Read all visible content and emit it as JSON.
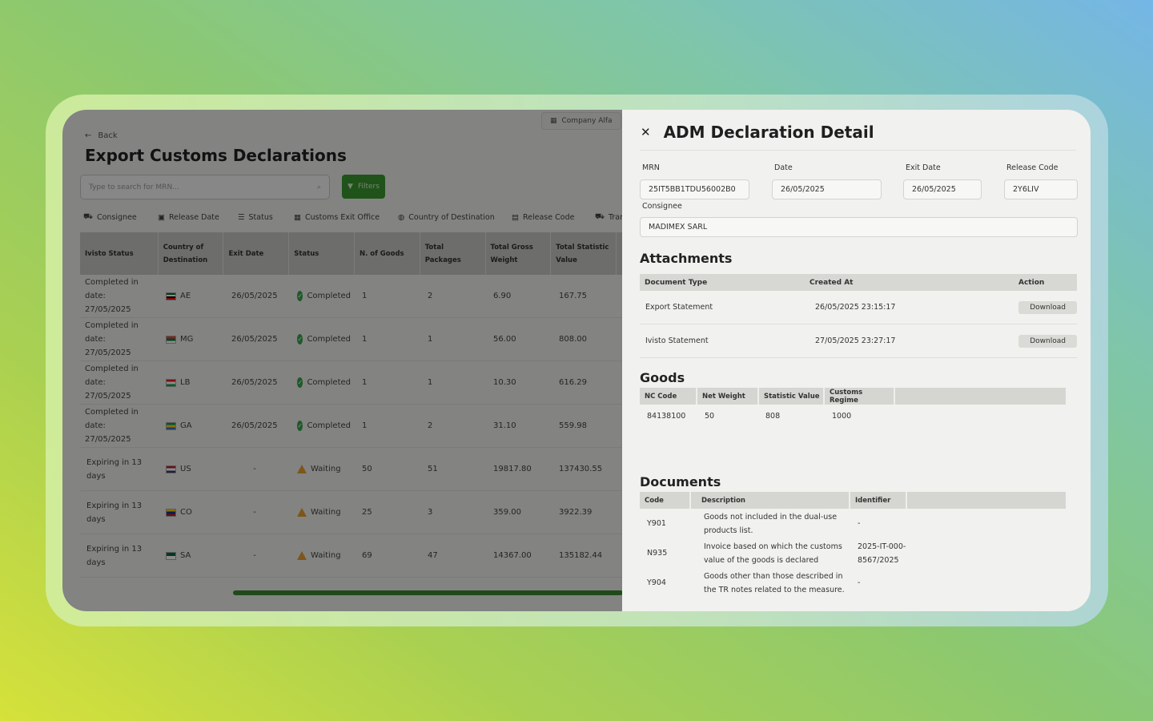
{
  "app": {
    "company": "Company Alfa",
    "back": "Back",
    "title": "Export Customs Declarations",
    "search_placeholder": "Type to search for  MRN...",
    "filters_label": "Filters",
    "filter_bar": [
      "Consignee",
      "Release Date",
      "Status",
      "Customs Exit Office",
      "Country of Destination",
      "Release Code",
      "Tran"
    ],
    "columns": [
      "Ivisto Status",
      "Country of Destination",
      "Exit Date",
      "Status",
      "N. of Goods",
      "Total Packages",
      "Total Gross Weight",
      "Total Statistic Value"
    ],
    "rows": [
      {
        "ivisto": "Completed in date: 27/05/2025",
        "country": "AE",
        "exit": "26/05/2025",
        "status": "Completed",
        "goods": "1",
        "packages": "2",
        "weight": "6.90",
        "value": "167.75",
        "kind": "ok"
      },
      {
        "ivisto": "Completed in date: 27/05/2025",
        "country": "MG",
        "exit": "26/05/2025",
        "status": "Completed",
        "goods": "1",
        "packages": "1",
        "weight": "56.00",
        "value": "808.00",
        "kind": "ok"
      },
      {
        "ivisto": "Completed in date: 27/05/2025",
        "country": "LB",
        "exit": "26/05/2025",
        "status": "Completed",
        "goods": "1",
        "packages": "1",
        "weight": "10.30",
        "value": "616.29",
        "kind": "ok"
      },
      {
        "ivisto": "Completed in date: 27/05/2025",
        "country": "GA",
        "exit": "26/05/2025",
        "status": "Completed",
        "goods": "1",
        "packages": "2",
        "weight": "31.10",
        "value": "559.98",
        "kind": "ok"
      },
      {
        "ivisto": "Expiring in 13 days",
        "country": "US",
        "exit": "-",
        "status": "Waiting",
        "goods": "50",
        "packages": "51",
        "weight": "19817.80",
        "value": "137430.55",
        "kind": "warn"
      },
      {
        "ivisto": "Expiring in 13 days",
        "country": "CO",
        "exit": "-",
        "status": "Waiting",
        "goods": "25",
        "packages": "3",
        "weight": "359.00",
        "value": "3922.39",
        "kind": "warn"
      },
      {
        "ivisto": "Expiring in 13 days",
        "country": "SA",
        "exit": "-",
        "status": "Waiting",
        "goods": "69",
        "packages": "47",
        "weight": "14367.00",
        "value": "135182.44",
        "kind": "warn"
      }
    ]
  },
  "detail": {
    "title": "ADM Declaration Detail",
    "fields": {
      "mrn_label": "MRN",
      "mrn": "25IT5BB1TDU56002B0",
      "date_label": "Date",
      "date": "26/05/2025",
      "exit_label": "Exit Date",
      "exit": "26/05/2025",
      "release_label": "Release Code",
      "release": "2Y6LIV",
      "consignee_label": "Consignee",
      "consignee": "MADIMEX SARL"
    },
    "attachments": {
      "title": "Attachments",
      "headers": [
        "Document Type",
        "Created At",
        "Action"
      ],
      "rows": [
        {
          "type": "Export Statement",
          "created": "26/05/2025 23:15:17",
          "action": "Download"
        },
        {
          "type": "Ivisto Statement",
          "created": "27/05/2025 23:27:17",
          "action": "Download"
        }
      ]
    },
    "goods": {
      "title": "Goods",
      "headers": [
        "NC Code",
        "Net Weight",
        "Statistic Value",
        "Customs Regime"
      ],
      "rows": [
        {
          "nc": "84138100",
          "net": "50",
          "stat": "808",
          "regime": "1000"
        }
      ]
    },
    "documents": {
      "title": "Documents",
      "headers": [
        "Code",
        "Description",
        "Identifier"
      ],
      "rows": [
        {
          "code": "Y901",
          "desc": "Goods not included in the dual-use products list.",
          "id": "-"
        },
        {
          "code": "N935",
          "desc": "Invoice based on which the customs value of the goods is declared",
          "id": "2025-IT-000-8567/2025"
        },
        {
          "code": "Y904",
          "desc": "Goods other than those described in the TR notes related to the measure.",
          "id": "-"
        }
      ]
    }
  },
  "colors": {
    "accent": "#3a9a2f",
    "ok": "#3aa54a",
    "warn": "#e8a030"
  },
  "flags": {
    "AE": [
      "#00732f",
      "#ffffff",
      "#000000",
      "#ff0000"
    ],
    "MG": [
      "#fc3d32",
      "#007e3a",
      "#ffffff"
    ],
    "LB": [
      "#ed1c24",
      "#ffffff",
      "#00a651"
    ],
    "GA": [
      "#009e60",
      "#fcd116",
      "#3a75c4"
    ],
    "US": [
      "#b22234",
      "#ffffff",
      "#3c3b6e"
    ],
    "CO": [
      "#fcd116",
      "#003893",
      "#ce1126"
    ],
    "SA": [
      "#006c35",
      "#ffffff"
    ]
  }
}
